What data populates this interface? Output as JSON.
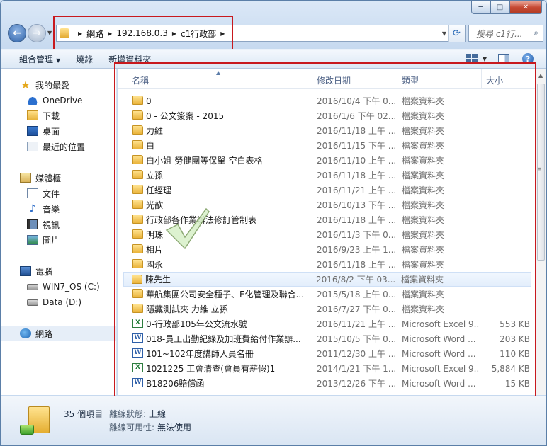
{
  "window": {
    "caption_buttons": [
      "─",
      "□",
      "✕"
    ]
  },
  "address": {
    "crumbs": [
      "網路",
      "192.168.0.3",
      "c1行政部"
    ]
  },
  "search": {
    "placeholder": "搜尋 c1行..."
  },
  "toolbar": {
    "organize": "組合管理",
    "burn": "燒錄",
    "new_folder": "新增資料夾"
  },
  "sidebar": {
    "favorites": {
      "label": "我的最愛",
      "items": [
        "OneDrive",
        "下載",
        "桌面",
        "最近的位置"
      ]
    },
    "libraries": {
      "label": "媒體櫃",
      "items": [
        "文件",
        "音樂",
        "視訊",
        "圖片"
      ]
    },
    "computer": {
      "label": "電腦",
      "items": [
        "WIN7_OS (C:)",
        "Data (D:)"
      ]
    },
    "network": {
      "label": "網路"
    }
  },
  "columns": {
    "name": "名稱",
    "date": "修改日期",
    "type": "類型",
    "size": "大小"
  },
  "files": [
    {
      "name": "0",
      "date": "2016/10/4 下午 0...",
      "type": "檔案資料夾",
      "size": "",
      "kind": "folder"
    },
    {
      "name": "0 - 公文簽案 - 2015",
      "date": "2016/1/6 下午 02...",
      "type": "檔案資料夾",
      "size": "",
      "kind": "folder"
    },
    {
      "name": "力維",
      "date": "2016/11/18 上午 ...",
      "type": "檔案資料夾",
      "size": "",
      "kind": "folder"
    },
    {
      "name": "白",
      "date": "2016/11/15 下午 ...",
      "type": "檔案資料夾",
      "size": "",
      "kind": "folder"
    },
    {
      "name": "白小姐-勞健團等保單-空白表格",
      "date": "2016/11/10 上午 ...",
      "type": "檔案資料夾",
      "size": "",
      "kind": "folder"
    },
    {
      "name": "立孫",
      "date": "2016/11/18 上午 ...",
      "type": "檔案資料夾",
      "size": "",
      "kind": "folder"
    },
    {
      "name": "任經理",
      "date": "2016/11/21 上午 ...",
      "type": "檔案資料夾",
      "size": "",
      "kind": "folder"
    },
    {
      "name": "光歆",
      "date": "2016/10/13 下午 ...",
      "type": "檔案資料夾",
      "size": "",
      "kind": "folder"
    },
    {
      "name": "行政部各作業辦法修訂管制表",
      "date": "2016/11/18 上午 ...",
      "type": "檔案資料夾",
      "size": "",
      "kind": "folder"
    },
    {
      "name": "明珠",
      "date": "2016/11/3 下午 0...",
      "type": "檔案資料夾",
      "size": "",
      "kind": "folder"
    },
    {
      "name": "相片",
      "date": "2016/9/23 上午 1...",
      "type": "檔案資料夾",
      "size": "",
      "kind": "folder"
    },
    {
      "name": "國永",
      "date": "2016/11/18 上午 ...",
      "type": "檔案資料夾",
      "size": "",
      "kind": "folder"
    },
    {
      "name": "陳先生",
      "date": "2016/8/2 下午 03...",
      "type": "檔案資料夾",
      "size": "",
      "kind": "folder",
      "selected": true
    },
    {
      "name": "華航集團公司安全種子、E化管理及聯合...",
      "date": "2015/5/18 上午 0...",
      "type": "檔案資料夾",
      "size": "",
      "kind": "folder"
    },
    {
      "name": "隱藏測試夾 力維 立孫",
      "date": "2016/7/27 下午 0...",
      "type": "檔案資料夾",
      "size": "",
      "kind": "folder"
    },
    {
      "name": "0-行政部105年公文流水號",
      "date": "2016/11/21 上午 ...",
      "type": "Microsoft Excel 9...",
      "size": "553 KB",
      "kind": "excel"
    },
    {
      "name": "018-員工出勤紀錄及加班費給付作業辦...",
      "date": "2015/10/5 下午 0...",
      "type": "Microsoft Word ...",
      "size": "203 KB",
      "kind": "word"
    },
    {
      "name": "101~102年度講師人員名冊",
      "date": "2011/12/30 上午 ...",
      "type": "Microsoft Word ...",
      "size": "110 KB",
      "kind": "word"
    },
    {
      "name": "1021225 工會清查(會員有薪假)1",
      "date": "2014/1/21 下午 1...",
      "type": "Microsoft Excel 9...",
      "size": "5,884 KB",
      "kind": "excel"
    },
    {
      "name": "B18206賠償函",
      "date": "2013/12/26 下午 ...",
      "type": "Microsoft Word ...",
      "size": "15 KB",
      "kind": "word"
    }
  ],
  "status": {
    "count": "35 個項目",
    "offline_status_label": "離線狀態:",
    "offline_status_value": "上線",
    "offline_avail_label": "離線可用性:",
    "offline_avail_value": "無法使用"
  }
}
